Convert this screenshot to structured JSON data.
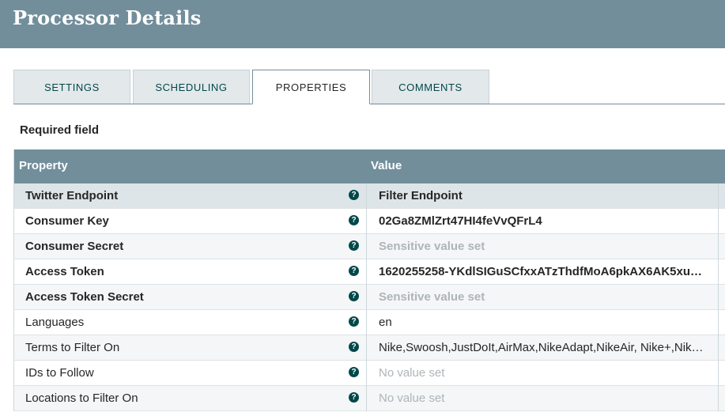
{
  "header": {
    "title": "Processor Details"
  },
  "tabs": [
    {
      "label": "SETTINGS"
    },
    {
      "label": "SCHEDULING"
    },
    {
      "label": "PROPERTIES",
      "selected": true
    },
    {
      "label": "COMMENTS"
    }
  ],
  "required_label": "Required field",
  "table": {
    "columns": {
      "property": "Property",
      "value": "Value"
    },
    "rows": [
      {
        "name": "Twitter Endpoint",
        "value": "Filter Endpoint",
        "required": true,
        "value_state": "set"
      },
      {
        "name": "Consumer Key",
        "value": "02Ga8ZMlZrt47HI4feVvQFrL4",
        "required": true,
        "value_state": "set"
      },
      {
        "name": "Consumer Secret",
        "value": "Sensitive value set",
        "required": true,
        "value_state": "sensitive"
      },
      {
        "name": "Access Token",
        "value": "1620255258-YKdlSIGuSCfxxATzThdfMoA6pkAX6AK5xu…",
        "required": true,
        "value_state": "set"
      },
      {
        "name": "Access Token Secret",
        "value": "Sensitive value set",
        "required": true,
        "value_state": "sensitive"
      },
      {
        "name": "Languages",
        "value": "en",
        "required": false,
        "value_state": "set"
      },
      {
        "name": "Terms to Filter On",
        "value": "Nike,Swoosh,JustDoIt,AirMax,NikeAdapt,NikeAir, Nike+,Nik…",
        "required": false,
        "value_state": "set"
      },
      {
        "name": "IDs to Follow",
        "value": "No value set",
        "required": false,
        "value_state": "empty"
      },
      {
        "name": "Locations to Filter On",
        "value": "No value set",
        "required": false,
        "value_state": "empty"
      }
    ],
    "help_icon": "question-circle-icon"
  },
  "colors": {
    "header_bg": "#728e9b",
    "accent": "#004849",
    "muted_text": "#aeb5b8"
  }
}
